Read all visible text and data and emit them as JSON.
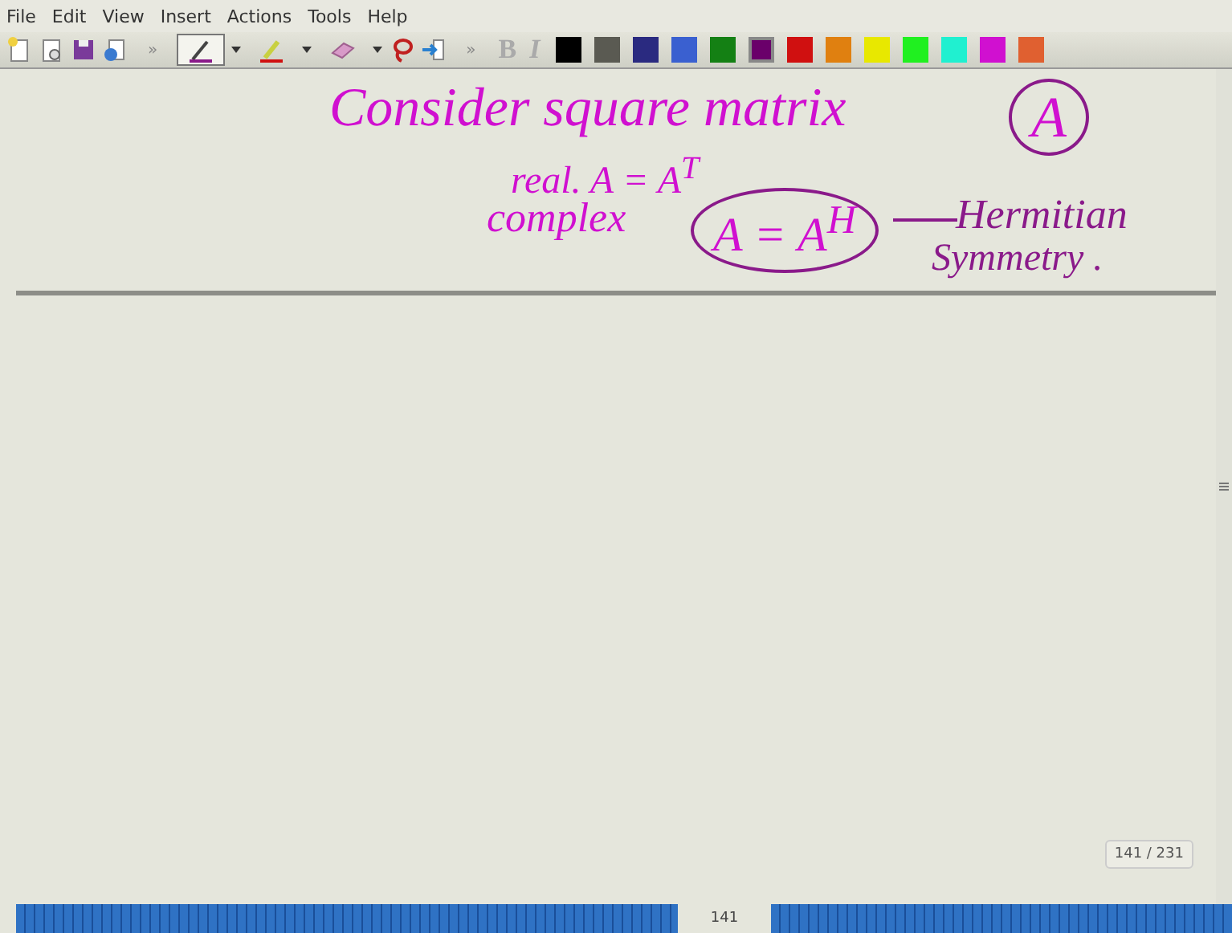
{
  "menu": [
    "File",
    "Edit",
    "View",
    "Insert",
    "Actions",
    "Tools",
    "Help"
  ],
  "toolbar": {
    "overflow": "»",
    "tools": [
      {
        "kind": "pen",
        "selected": true
      },
      {
        "kind": "highlighter",
        "selected": false
      },
      {
        "kind": "eraser",
        "selected": false
      }
    ],
    "bold": "B",
    "italic": "I",
    "swatches": [
      {
        "color": "#000000",
        "selected": false
      },
      {
        "color": "#5a5a52",
        "selected": false
      },
      {
        "color": "#2a2a80",
        "selected": false
      },
      {
        "color": "#3a60d0",
        "selected": false
      },
      {
        "color": "#148014",
        "selected": false
      },
      {
        "color": "#6a006a",
        "selected": true
      },
      {
        "color": "#d01010",
        "selected": false
      },
      {
        "color": "#e08010",
        "selected": false
      },
      {
        "color": "#e8e800",
        "selected": false
      },
      {
        "color": "#20f020",
        "selected": false
      },
      {
        "color": "#20f0d0",
        "selected": false
      },
      {
        "color": "#d010d0",
        "selected": false
      },
      {
        "color": "#e06030",
        "selected": false
      }
    ]
  },
  "notes": [
    {
      "kind": "line",
      "text": "Consider square matrix"
    },
    {
      "kind": "circled",
      "text": "A"
    },
    {
      "kind": "line",
      "text": "real.  A = A$^{T}$"
    },
    {
      "kind": "line",
      "text": "complex"
    },
    {
      "kind": "ellipsed",
      "text": "A = A$^{H}$"
    },
    {
      "kind": "label",
      "text": "Hermitian"
    },
    {
      "kind": "label",
      "text": "Symmetry ."
    }
  ],
  "page_counter": "141 / 231",
  "page_number": "141"
}
